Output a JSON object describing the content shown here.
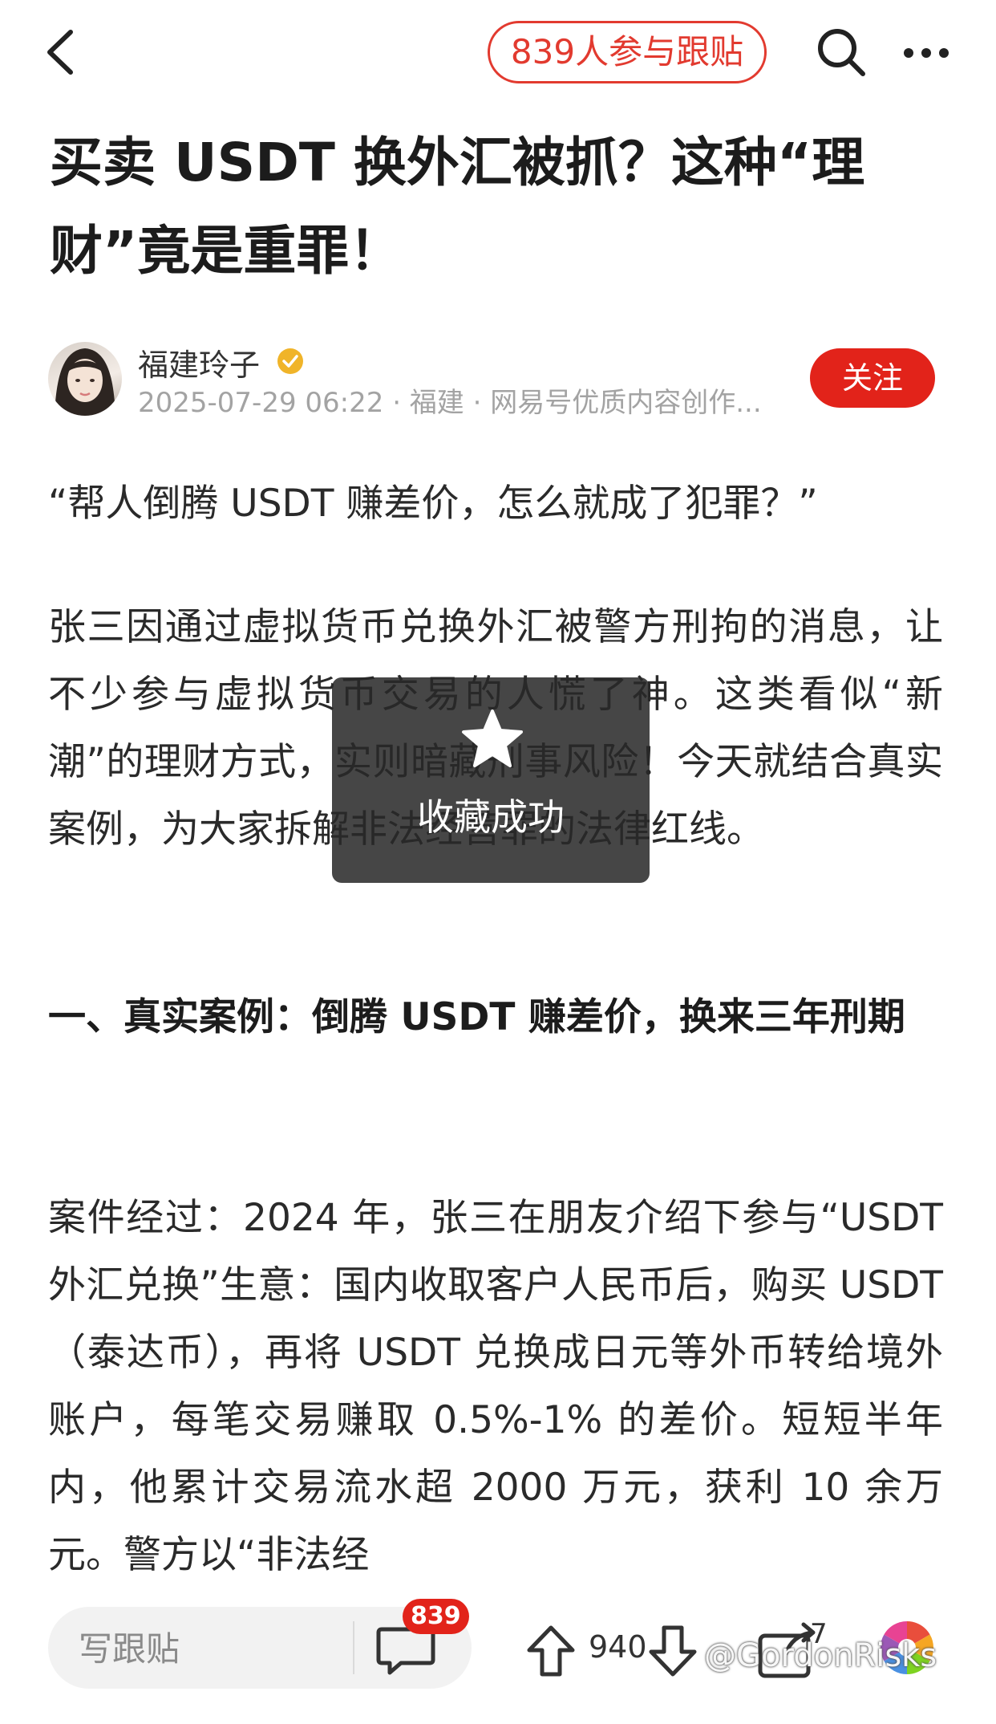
{
  "header": {
    "followers_pill": "839人参与跟贴"
  },
  "article": {
    "title": "买卖 USDT 换外汇被抓？这种“理财”竟是重罪！",
    "author": {
      "name": "福建玲子",
      "meta": "2025-07-29 06:22 · 福建 · 网易号优质内容创作...",
      "follow_label": "关注"
    },
    "paragraphs": [
      "“帮人倒腾 USDT 赚差价，怎么就成了犯罪？”",
      "张三因通过虚拟货币兑换外汇被警方刑拘的消息，让不少参与虚拟货币交易的人慌了神。这类看似“新潮”的理财方式，实则暗藏刑事风险！今天就结合真实案例，为大家拆解非法经营罪的法律红线。",
      "一、真实案例：倒腾 USDT 赚差价，换来三年刑期",
      "案件经过：2024 年，张三在朋友介绍下参与“USDT 外汇兑换”生意：国内收取客户人民币后，购买 USDT（泰达币），再将 USDT 兑换成日元等外币转给境外账户，每笔交易赚取 0.5%-1% 的差价。短短半年内，他累计交易流水超 2000 万元，获利 10 余万元。警方以“非法经"
    ]
  },
  "toast": {
    "text": "收藏成功"
  },
  "bottom_bar": {
    "reply_placeholder": "写跟贴",
    "comment_count": "839",
    "upvote_count": "940",
    "share_count": "7",
    "watermark": "@GordonRisks"
  },
  "colors": {
    "accent_red": "#e2231a",
    "verify_gold": "#f0b429"
  }
}
